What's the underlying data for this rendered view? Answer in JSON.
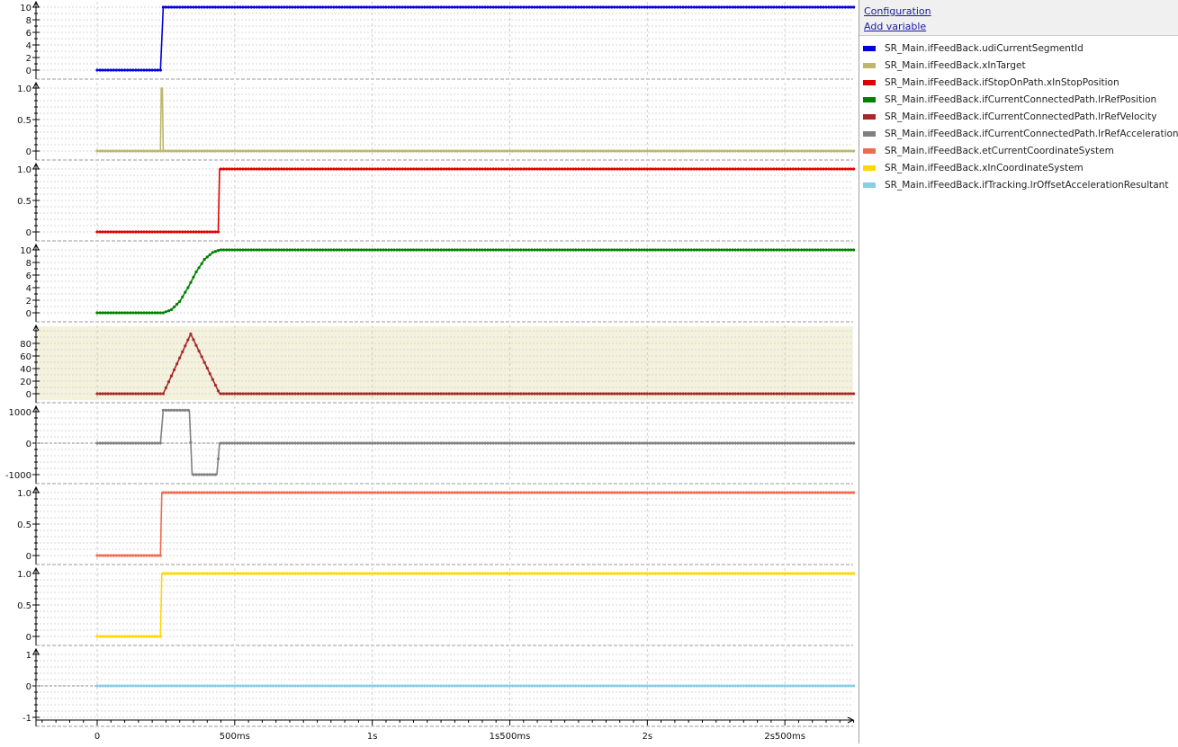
{
  "panel": {
    "configuration_label": "Configuration",
    "add_variable_label": "Add variable"
  },
  "legend": [
    {
      "name": "SR_Main.ifFeedBack.udiCurrentSegmentId",
      "color": "#0000e0"
    },
    {
      "name": "SR_Main.ifFeedBack.xInTarget",
      "color": "#bdb76b"
    },
    {
      "name": "SR_Main.ifFeedBack.ifStopOnPath.xInStopPosition",
      "color": "#e00000"
    },
    {
      "name": "SR_Main.ifFeedBack.ifCurrentConnectedPath.lrRefPosition",
      "color": "#008000"
    },
    {
      "name": "SR_Main.ifFeedBack.ifCurrentConnectedPath.lrRefVelocity",
      "color": "#a52a2a"
    },
    {
      "name": "SR_Main.ifFeedBack.ifCurrentConnectedPath.lrRefAcceleration",
      "color": "#808080"
    },
    {
      "name": "SR_Main.ifFeedBack.etCurrentCoordinateSystem",
      "color": "#f06a50"
    },
    {
      "name": "SR_Main.ifFeedBack.xInCoordinateSystem",
      "color": "#ffd700"
    },
    {
      "name": "SR_Main.ifFeedBack.ifTracking.lrOffsetAccelerationResultant",
      "color": "#87cee6"
    }
  ],
  "x_axis": {
    "tick_labels": [
      "0",
      "500ms",
      "1s",
      "1s500ms",
      "2s",
      "2s500ms"
    ],
    "tick_values_ms": [
      0,
      500,
      1000,
      1500,
      2000,
      2500
    ],
    "range_ms": [
      -200,
      2750
    ]
  },
  "chart_data": [
    {
      "type": "line",
      "series": [
        {
          "name": "SR_Main.ifFeedBack.udiCurrentSegmentId",
          "color": "#0000e0",
          "step": true,
          "points": [
            [
              0,
              0
            ],
            [
              230,
              0
            ],
            [
              240,
              10
            ],
            [
              2750,
              10
            ]
          ]
        }
      ],
      "ylim": [
        0,
        10
      ],
      "ytick_labels": [
        "0",
        "2",
        "4",
        "6",
        "8",
        "10"
      ],
      "ytick_values": [
        0,
        2,
        4,
        6,
        8,
        10
      ]
    },
    {
      "type": "line",
      "series": [
        {
          "name": "SR_Main.ifFeedBack.xInTarget",
          "color": "#bdb76b",
          "step": true,
          "points": [
            [
              0,
              0
            ],
            [
              230,
              0
            ],
            [
              233,
              1
            ],
            [
              237,
              1
            ],
            [
              240,
              0
            ],
            [
              2750,
              0
            ]
          ]
        }
      ],
      "ylim": [
        0,
        1
      ],
      "ytick_labels": [
        "0",
        "0.5",
        "1.0"
      ],
      "ytick_values": [
        0,
        0.5,
        1
      ]
    },
    {
      "type": "line",
      "series": [
        {
          "name": "SR_Main.ifFeedBack.ifStopOnPath.xInStopPosition",
          "color": "#e00000",
          "step": true,
          "points": [
            [
              0,
              0
            ],
            [
              440,
              0
            ],
            [
              445,
              1
            ],
            [
              2750,
              1
            ]
          ]
        }
      ],
      "ylim": [
        0,
        1
      ],
      "ytick_labels": [
        "0",
        "0.5",
        "1.0"
      ],
      "ytick_values": [
        0,
        0.5,
        1
      ]
    },
    {
      "type": "line",
      "series": [
        {
          "name": "SR_Main.ifFeedBack.ifCurrentConnectedPath.lrRefPosition",
          "color": "#008000",
          "step": false,
          "points": [
            [
              0,
              0
            ],
            [
              240,
              0
            ],
            [
              270,
              0.5
            ],
            [
              300,
              1.8
            ],
            [
              330,
              4
            ],
            [
              360,
              6.5
            ],
            [
              390,
              8.5
            ],
            [
              420,
              9.6
            ],
            [
              445,
              10
            ],
            [
              2750,
              10
            ]
          ]
        }
      ],
      "ylim": [
        0,
        10
      ],
      "ytick_labels": [
        "0",
        "2",
        "4",
        "6",
        "8",
        "10"
      ],
      "ytick_values": [
        0,
        2,
        4,
        6,
        8,
        10
      ]
    },
    {
      "type": "line",
      "series": [
        {
          "name": "SR_Main.ifFeedBack.ifCurrentConnectedPath.lrRefVelocity",
          "color": "#a52a2a",
          "step": false,
          "points": [
            [
              0,
              0
            ],
            [
              240,
              0
            ],
            [
              340,
              95
            ],
            [
              445,
              0
            ],
            [
              2750,
              0
            ]
          ]
        }
      ],
      "ylim": [
        0,
        100
      ],
      "ytick_labels": [
        "0",
        "20",
        "40",
        "60",
        "80"
      ],
      "ytick_values": [
        0,
        20,
        40,
        60,
        80
      ],
      "highlight": true
    },
    {
      "type": "line",
      "series": [
        {
          "name": "SR_Main.ifFeedBack.ifCurrentConnectedPath.lrRefAcceleration",
          "color": "#808080",
          "step": true,
          "points": [
            [
              0,
              0
            ],
            [
              230,
              0
            ],
            [
              240,
              1050
            ],
            [
              335,
              1050
            ],
            [
              345,
              -1000
            ],
            [
              435,
              -1000
            ],
            [
              445,
              0
            ],
            [
              2750,
              0
            ]
          ]
        }
      ],
      "ylim": [
        -1000,
        1000
      ],
      "ytick_labels": [
        "-1000",
        "0",
        "1000"
      ],
      "ytick_values": [
        -1000,
        0,
        1000
      ]
    },
    {
      "type": "line",
      "series": [
        {
          "name": "SR_Main.ifFeedBack.etCurrentCoordinateSystem",
          "color": "#f06a50",
          "step": true,
          "points": [
            [
              0,
              0
            ],
            [
              230,
              0
            ],
            [
              235,
              1
            ],
            [
              2750,
              1
            ]
          ]
        }
      ],
      "ylim": [
        0,
        1
      ],
      "ytick_labels": [
        "0",
        "0.5",
        "1.0"
      ],
      "ytick_values": [
        0,
        0.5,
        1
      ]
    },
    {
      "type": "line",
      "series": [
        {
          "name": "SR_Main.ifFeedBack.xInCoordinateSystem",
          "color": "#ffd700",
          "step": true,
          "points": [
            [
              0,
              0
            ],
            [
              230,
              0
            ],
            [
              235,
              1
            ],
            [
              2750,
              1
            ]
          ]
        }
      ],
      "ylim": [
        0,
        1
      ],
      "ytick_labels": [
        "0",
        "0.5",
        "1.0"
      ],
      "ytick_values": [
        0,
        0.5,
        1
      ]
    },
    {
      "type": "line",
      "series": [
        {
          "name": "SR_Main.ifFeedBack.ifTracking.lrOffsetAccelerationResultant",
          "color": "#87cee6",
          "step": false,
          "points": [
            [
              0,
              0
            ],
            [
              2750,
              0
            ]
          ]
        }
      ],
      "ylim": [
        -1,
        1
      ],
      "ytick_labels": [
        "-1",
        "0",
        "1"
      ],
      "ytick_values": [
        -1,
        0,
        1
      ]
    }
  ]
}
